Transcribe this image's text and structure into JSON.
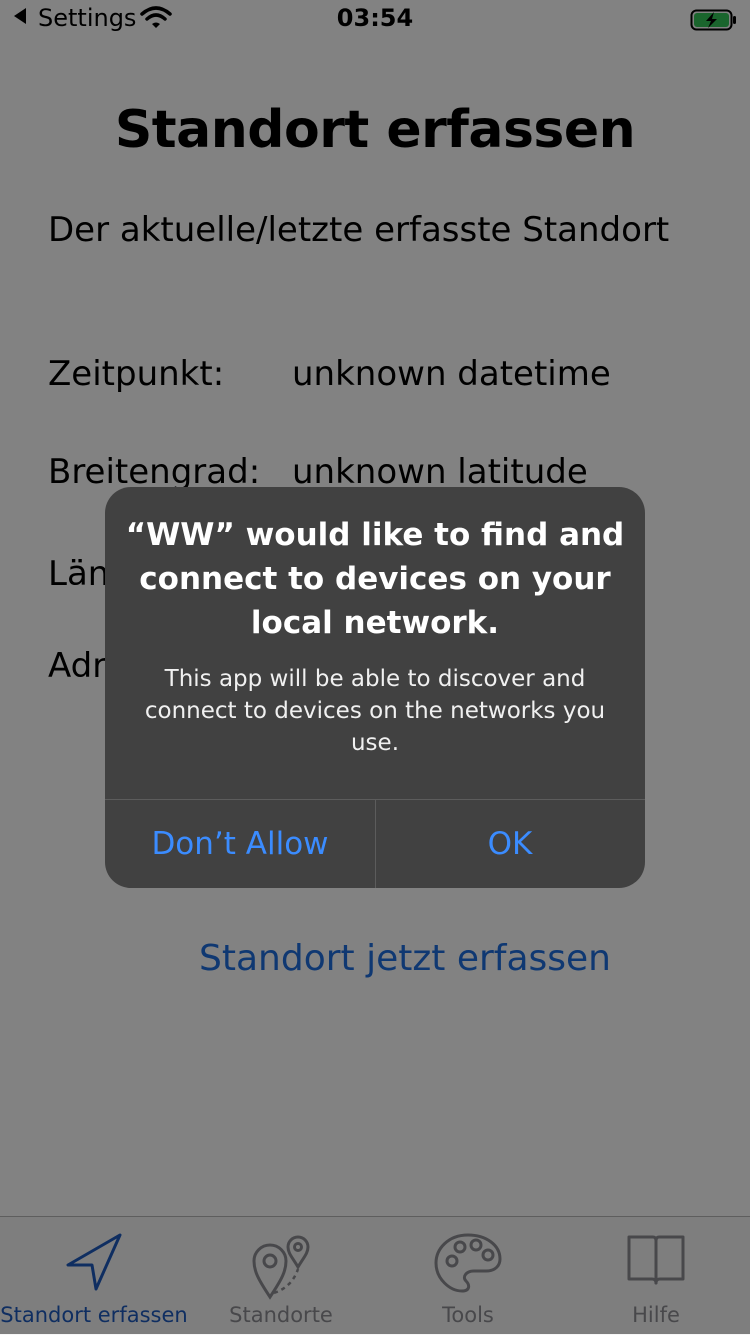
{
  "status_bar": {
    "back_label": "Settings",
    "time": "03:54"
  },
  "main": {
    "title": "Standort erfassen",
    "subtitle": "Der aktuelle/letzte erfasste Standort",
    "rows": [
      {
        "label": "Zeitpunkt:",
        "value": "unknown datetime"
      },
      {
        "label": "Breitengrad:",
        "value": "unknown latitude"
      },
      {
        "label": "Län",
        "value": ""
      },
      {
        "label": "Adr",
        "value": ""
      }
    ],
    "capture_button_label": "Standort jetzt erfassen"
  },
  "alert": {
    "title": "“WW” would like to find and connect to devices on your local network.",
    "message": "This app will be able to discover and connect to devices on the networks you use.",
    "buttons": {
      "dont_allow": "Don’t Allow",
      "ok": "OK"
    }
  },
  "tab_bar": {
    "items": [
      {
        "label": "Standort erfassen",
        "icon": "location-arrow-icon",
        "active": true
      },
      {
        "label": "Standorte",
        "icon": "map-pins-icon",
        "active": false
      },
      {
        "label": "Tools",
        "icon": "palette-icon",
        "active": false
      },
      {
        "label": "Hilfe",
        "icon": "book-icon",
        "active": false
      }
    ]
  },
  "colors": {
    "accent": "#1f6fe0",
    "alert_background": "#414141",
    "alert_button_text": "#3b8cff",
    "tab_inactive": "#8e8e93"
  }
}
